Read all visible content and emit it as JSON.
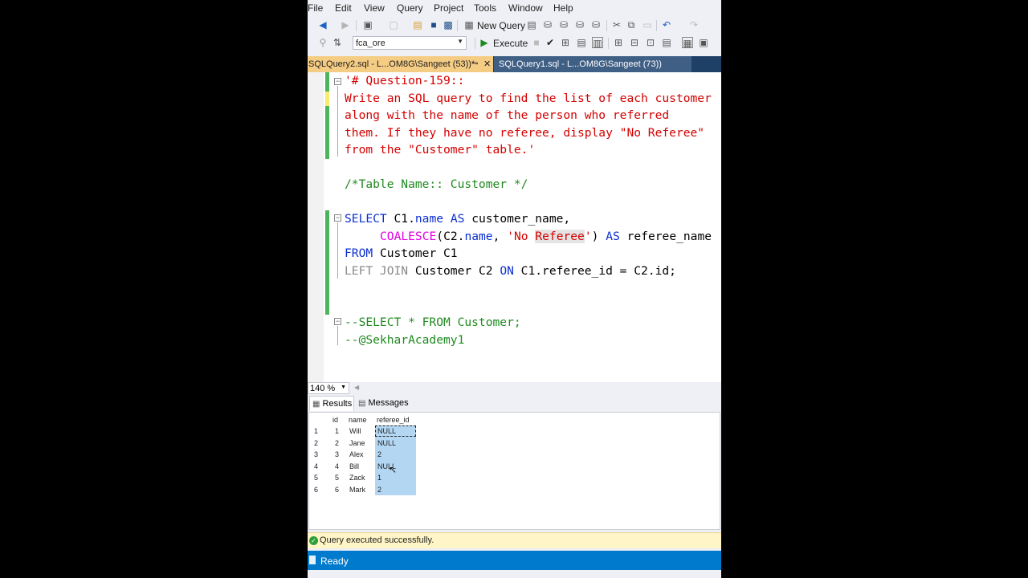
{
  "menu": [
    "File",
    "Edit",
    "View",
    "Query",
    "Project",
    "Tools",
    "Window",
    "Help"
  ],
  "toolbar": {
    "new_query": "New Query",
    "database": "fca_ore",
    "execute": "Execute"
  },
  "tabs": [
    {
      "label": "SQLQuery2.sql - L...OM8G\\Sangeet (53))*",
      "active": true
    },
    {
      "label": "SQLQuery1.sql - L...OM8G\\Sangeet (73))",
      "active": false
    }
  ],
  "editor": {
    "l1": "'# Question-159::",
    "l2": "Write an SQL query to find the list of each customer",
    "l3": "along with the name of the person who referred",
    "l4": "them. If they have no referee, display \"No Referee\"",
    "l5": "from the \"Customer\" table.'",
    "l6": "/*Table Name:: Customer */",
    "s_select": "SELECT",
    "s_c1": " C1.",
    "s_name": "name",
    "s_as": " AS ",
    "s_custname": "customer_name,",
    "s_coalesce": "COALESCE",
    "s_c2": "(C2.",
    "s_name2": "name",
    "s_comma": ", ",
    "s_str1": "'No ",
    "s_str2": "Referee",
    "s_str3": "'",
    "s_paren": ")",
    "s_as2": " AS ",
    "s_refname": "referee_name",
    "s_from": "FROM",
    "s_cust": " Customer C1",
    "s_leftjoin": "LEFT JOIN",
    "s_cust2": " Customer C2 ",
    "s_on": "ON",
    "s_cond": " C1.referee_id = C2.id;",
    "c1": "--SELECT * FROM Customer;",
    "c2": "--@SekharAcademy1"
  },
  "zoom": "140 %",
  "results_tabs": {
    "results": "Results",
    "messages": "Messages"
  },
  "grid": {
    "columns": [
      "id",
      "name",
      "referee_id"
    ],
    "rows": [
      {
        "n": "1",
        "id": "1",
        "name": "Will",
        "referee_id": "NULL"
      },
      {
        "n": "2",
        "id": "2",
        "name": "Jane",
        "referee_id": "NULL"
      },
      {
        "n": "3",
        "id": "3",
        "name": "Alex",
        "referee_id": "2"
      },
      {
        "n": "4",
        "id": "4",
        "name": "Bill",
        "referee_id": "NULL"
      },
      {
        "n": "5",
        "id": "5",
        "name": "Zack",
        "referee_id": "1"
      },
      {
        "n": "6",
        "id": "6",
        "name": "Mark",
        "referee_id": "2"
      }
    ]
  },
  "query_status": "Query executed successfully.",
  "status_bar": "Ready"
}
